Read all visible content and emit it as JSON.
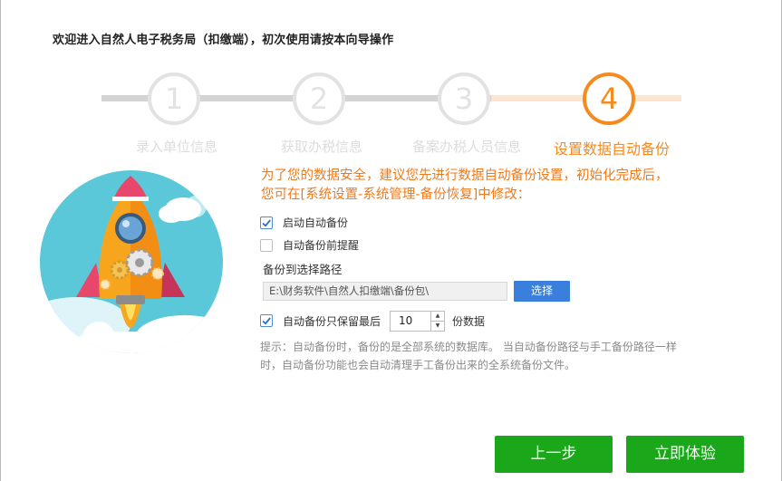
{
  "window": {
    "title": "欢迎进入自然人电子税务局（扣缴端），初次使用请按本向导操作"
  },
  "steps": [
    {
      "number": "1",
      "label": "录入单位信息",
      "state": "inactive"
    },
    {
      "number": "2",
      "label": "获取办税信息",
      "state": "inactive"
    },
    {
      "number": "3",
      "label": "备案办税人员信息",
      "state": "inactive"
    },
    {
      "number": "4",
      "label": "设置数据自动备份",
      "state": "active"
    }
  ],
  "content": {
    "intro": "为了您的数据安全，建议您先进行数据自动备份设置，初始化完成后，您可在[系统设置-系统管理-备份恢复]中修改：",
    "auto_backup": {
      "label": "启动自动备份",
      "checked": true
    },
    "remind_before": {
      "label": "自动备份前提醒",
      "checked": false
    },
    "path_section_label": "备份到选择路径",
    "path_value": "E:\\财务软件\\自然人扣缴端\\备份包\\",
    "browse_label": "选择",
    "keep_latest": {
      "prefix": "自动备份只保留最后",
      "value": "10",
      "suffix": "份数据",
      "checked": true
    },
    "hint": "提示：自动备份时，备份的是全部系统的数据库。 当自动备份路径与手工备份路径一样时，自动备份功能也会自动清理手工备份出来的全系统备份文件。"
  },
  "buttons": {
    "prev_label": "上一步",
    "finish_label": "立即体验"
  },
  "colors": {
    "accent": "#f58a1f",
    "inactive": "#e2e2e2",
    "button_green": "#1aa71a",
    "button_blue": "#3b7fdc",
    "checkbox": "#4a8fd8"
  },
  "icons": [
    "rocket-illustration",
    "check-icon",
    "caret-up-icon",
    "caret-down-icon"
  ]
}
